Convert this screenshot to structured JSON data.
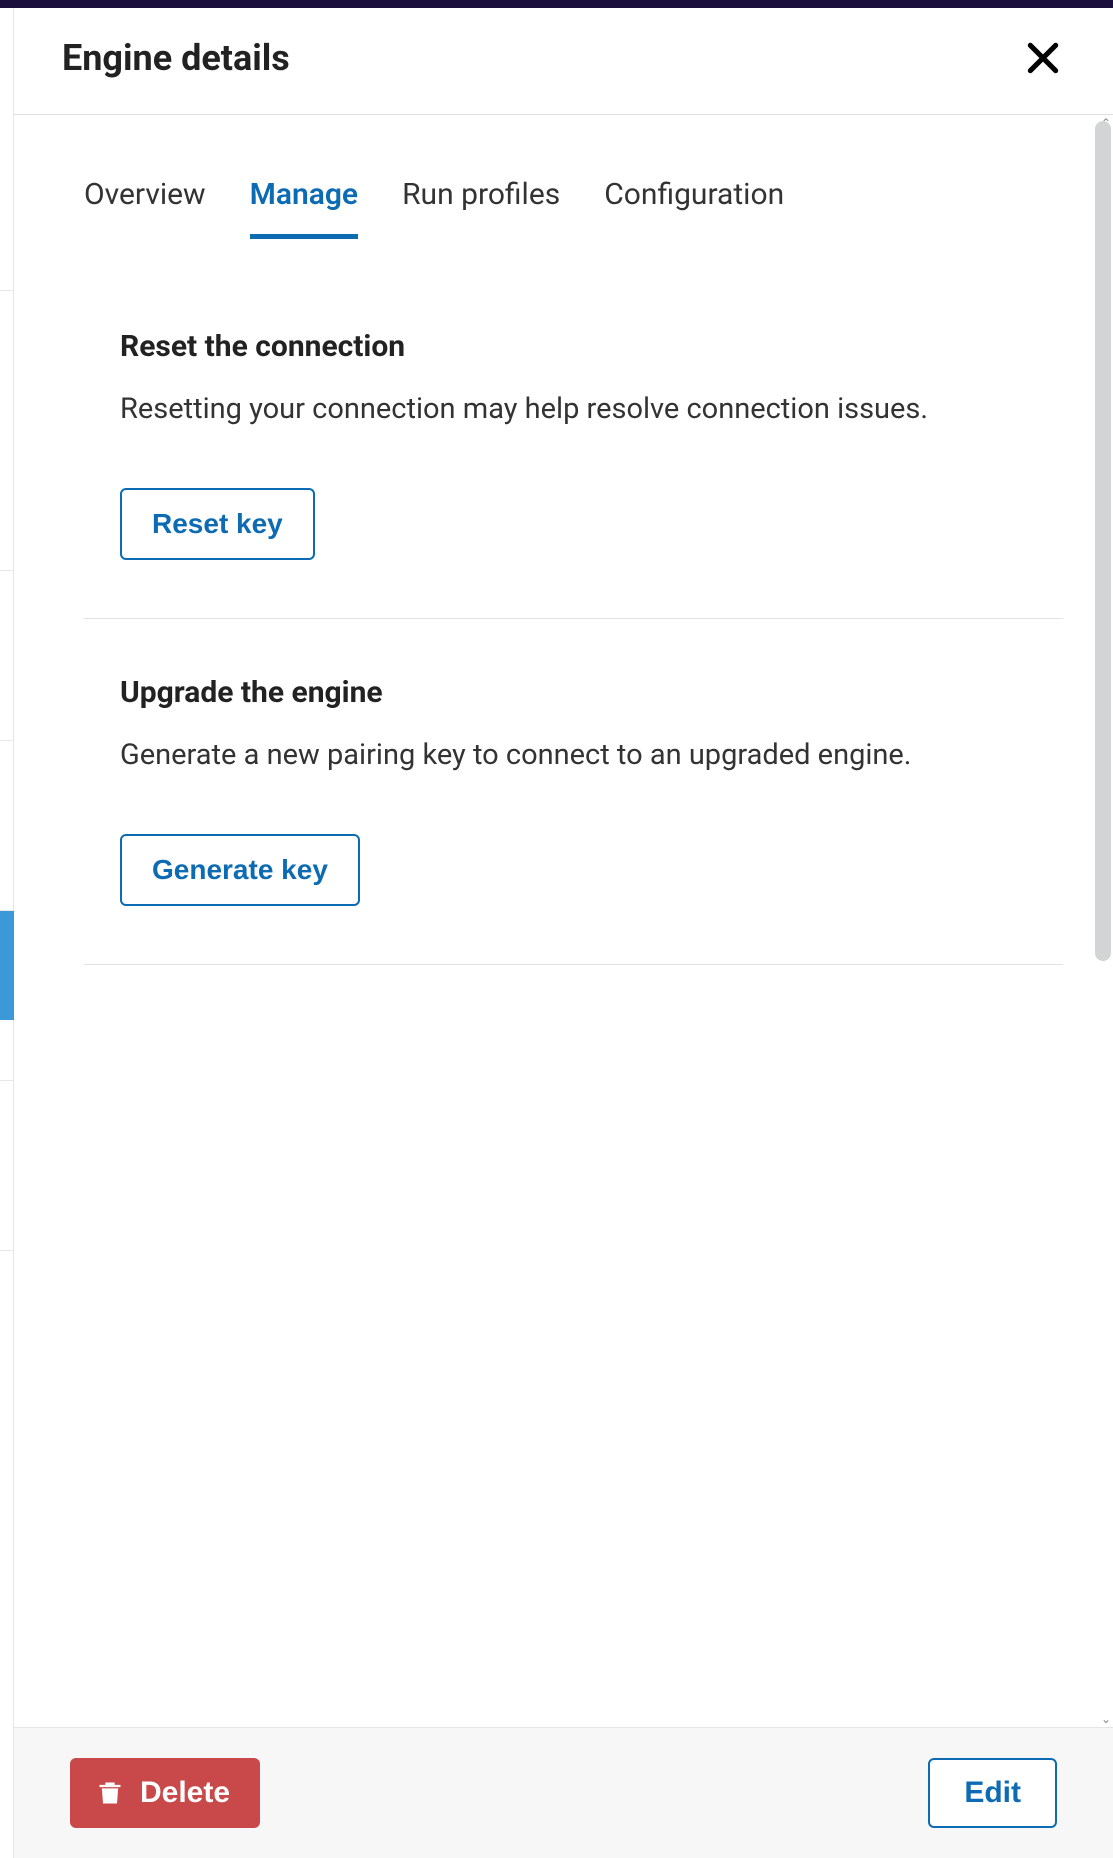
{
  "header": {
    "title": "Engine details"
  },
  "tabs": [
    {
      "label": "Overview",
      "active": false
    },
    {
      "label": "Manage",
      "active": true
    },
    {
      "label": "Run profiles",
      "active": false
    },
    {
      "label": "Configuration",
      "active": false
    }
  ],
  "sections": {
    "reset": {
      "title": "Reset the connection",
      "desc": "Resetting your connection may help resolve connection issues.",
      "button": "Reset key"
    },
    "upgrade": {
      "title": "Upgrade the engine",
      "desc": "Generate a new pairing key to connect to an upgraded engine.",
      "button": "Generate key"
    }
  },
  "footer": {
    "delete": "Delete",
    "edit": "Edit"
  },
  "colors": {
    "accent": "#0c6bb3",
    "danger": "#c9484a",
    "topbar": "#1a0f3d",
    "highlight": "#3b99d8"
  }
}
